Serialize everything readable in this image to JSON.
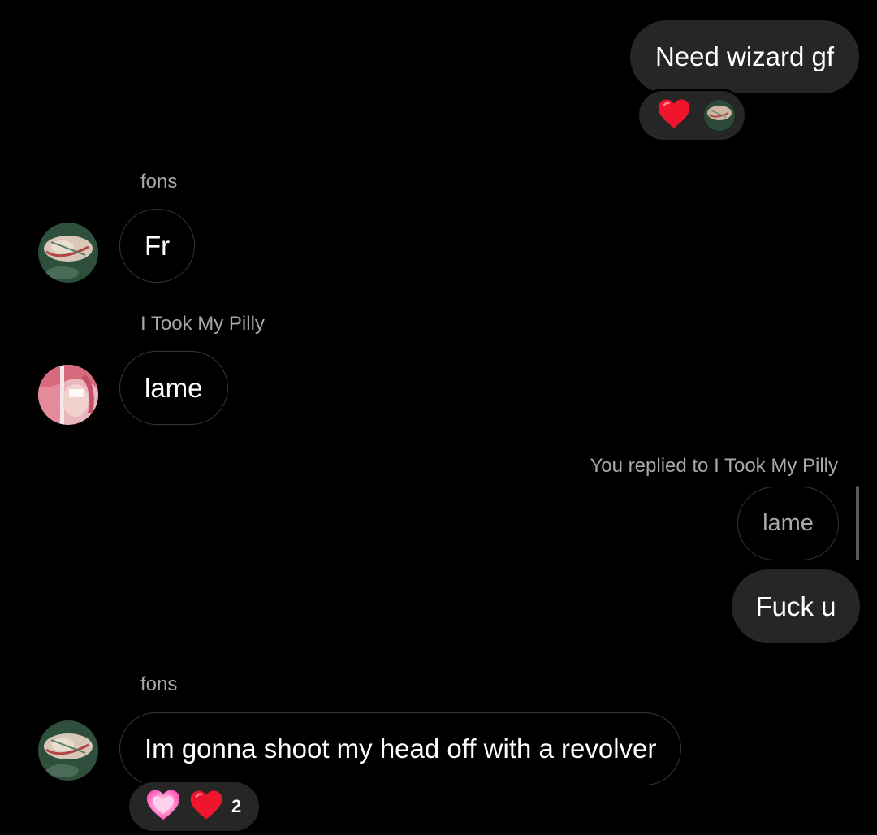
{
  "messages": {
    "m1": {
      "text": "Need wizard gf",
      "reaction_emoji": "❤️"
    },
    "m2": {
      "sender": "fons",
      "text": "Fr"
    },
    "m3": {
      "sender": "I Took My Pilly",
      "text": "lame"
    },
    "m4": {
      "reply_context": "You replied to I Took My Pilly",
      "quoted_text": "lame",
      "text": "Fuck u"
    },
    "m5": {
      "sender": "fons",
      "text": "Im gonna shoot my head off with a revolver",
      "reaction_emojis": [
        "💗",
        "❤️"
      ],
      "reaction_count": "2"
    }
  },
  "colors": {
    "background": "#000000",
    "outgoing_bubble": "#262626",
    "incoming_border": "#363636",
    "secondary_text": "#a8a8a8",
    "heart_red": "#f0142c",
    "heart_pink": "#ff4fb4"
  }
}
